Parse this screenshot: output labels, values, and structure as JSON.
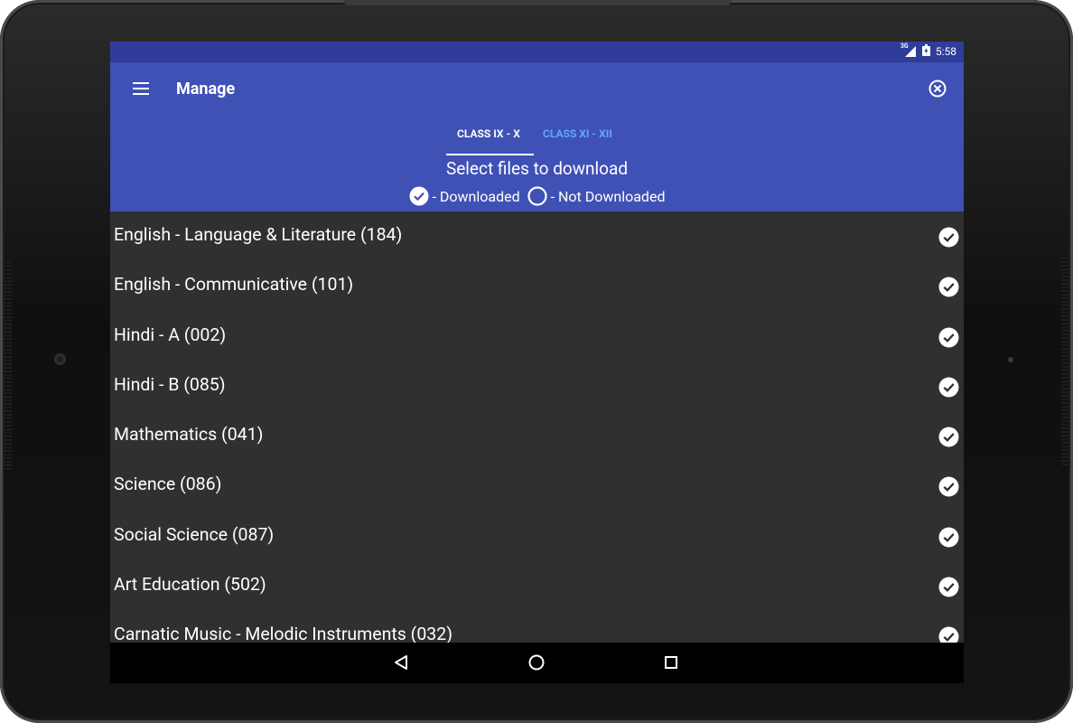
{
  "status_bar": {
    "network": "3G",
    "time": "5:58",
    "signal_icon": "cell-signal-icon",
    "battery_icon": "battery-icon"
  },
  "app_bar": {
    "title": "Manage",
    "menu_icon": "hamburger-menu-icon",
    "close_icon": "close-circle-icon"
  },
  "tabs": [
    {
      "label": "CLASS IX - X",
      "active": true
    },
    {
      "label": "CLASS XI - XII",
      "active": false
    }
  ],
  "header": {
    "heading": "Select files to download",
    "legend_downloaded": " - Downloaded",
    "legend_not_downloaded": " - Not Downloaded"
  },
  "subjects": [
    {
      "label": "English - Language & Literature (184)",
      "downloaded": true
    },
    {
      "label": "English - Communicative (101)",
      "downloaded": true
    },
    {
      "label": "Hindi - A (002)",
      "downloaded": true
    },
    {
      "label": "Hindi - B (085)",
      "downloaded": true
    },
    {
      "label": "Mathematics (041)",
      "downloaded": true
    },
    {
      "label": "Science (086)",
      "downloaded": true
    },
    {
      "label": "Social Science (087)",
      "downloaded": true
    },
    {
      "label": "Art Education (502)",
      "downloaded": true
    },
    {
      "label": "Carnatic Music - Melodic Instruments (032)",
      "downloaded": true
    }
  ],
  "nav_bar": {
    "back_icon": "back-triangle-icon",
    "home_icon": "home-circle-icon",
    "recents_icon": "recents-square-icon"
  },
  "colors": {
    "primary": "#3f51b5",
    "primary_dark": "#2f3d99",
    "list_bg": "#303030",
    "tab_inactive": "#5fa8ff"
  }
}
